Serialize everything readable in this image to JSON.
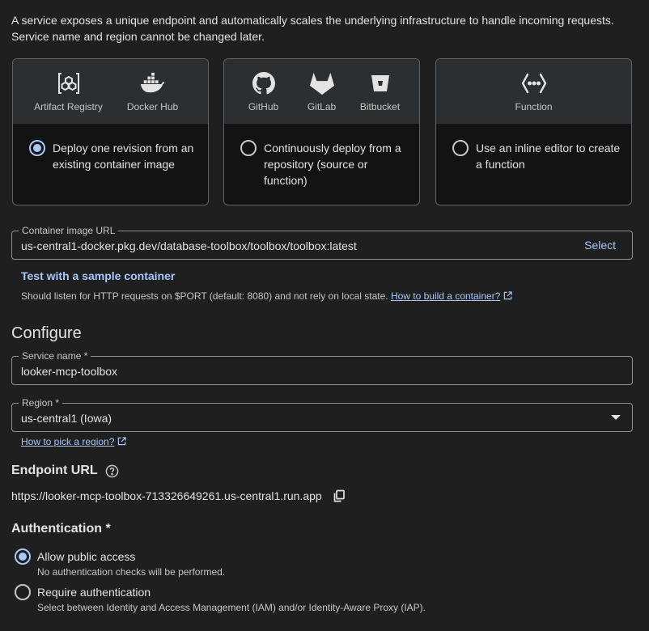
{
  "intro": {
    "line1": "A service exposes a unique endpoint and automatically scales the underlying infrastructure to handle incoming requests.",
    "line2": "Service name and region cannot be changed later."
  },
  "cards": [
    {
      "sources": [
        {
          "label": "Artifact Registry",
          "icon": "artifact-registry-icon"
        },
        {
          "label": "Docker Hub",
          "icon": "docker-icon"
        }
      ],
      "option": "Deploy one revision from an existing container image",
      "selected": true
    },
    {
      "sources": [
        {
          "label": "GitHub",
          "icon": "github-icon"
        },
        {
          "label": "GitLab",
          "icon": "gitlab-icon"
        },
        {
          "label": "Bitbucket",
          "icon": "bitbucket-icon"
        }
      ],
      "option": "Continuously deploy from a repository (source or function)",
      "selected": false
    },
    {
      "sources": [
        {
          "label": "Function",
          "icon": "function-icon"
        }
      ],
      "option": "Use an inline editor to create a function",
      "selected": false
    }
  ],
  "container": {
    "label": "Container image URL",
    "value": "us-central1-docker.pkg.dev/database-toolbox/toolbox/toolbox:latest",
    "select_label": "Select",
    "test_link": "Test with a sample container",
    "hint": "Should listen for HTTP requests on $PORT (default: 8080) and not rely on local state.",
    "hint_link": "How to build a container?"
  },
  "configure": {
    "heading": "Configure",
    "service_label": "Service name *",
    "service_value": "looker-mcp-toolbox",
    "region_label": "Region *",
    "region_value": "us-central1 (Iowa)",
    "region_link": "How to pick a region?"
  },
  "endpoint": {
    "heading": "Endpoint URL",
    "url": "https://looker-mcp-toolbox-713326649261.us-central1.run.app"
  },
  "auth": {
    "heading": "Authentication *",
    "options": [
      {
        "title": "Allow public access",
        "desc": "No authentication checks will be performed.",
        "selected": true
      },
      {
        "title": "Require authentication",
        "desc": "Select between Identity and Access Management (IAM) and/or Identity-Aware Proxy (IAP).",
        "selected": false
      }
    ]
  },
  "colors": {
    "accent": "#a8c7fa",
    "background": "#1f1f1f",
    "card_header": "#2d2e30"
  }
}
